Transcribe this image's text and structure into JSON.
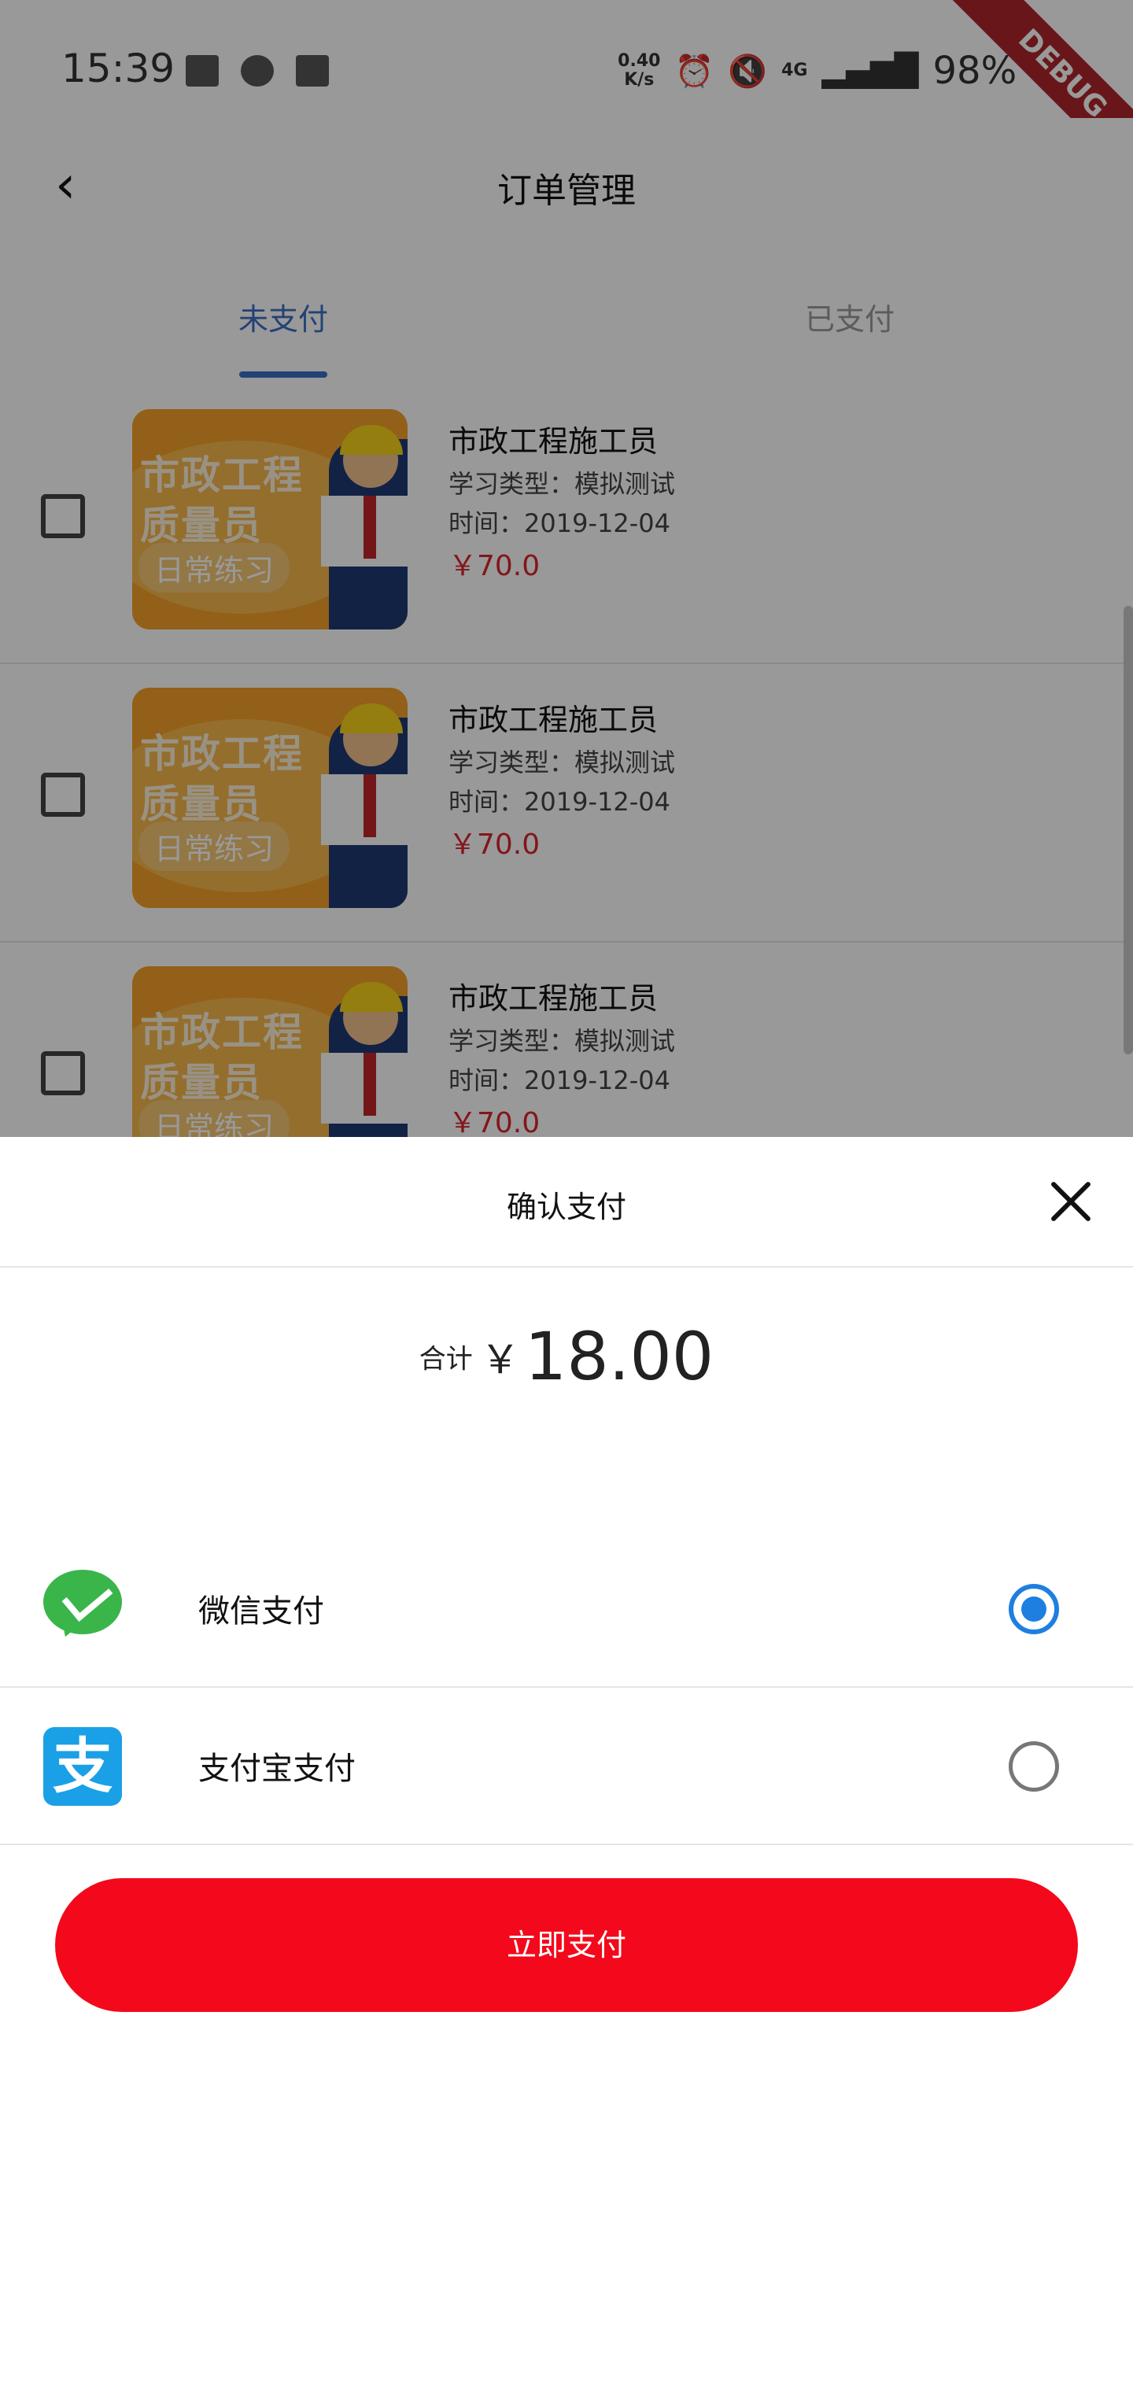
{
  "status_bar": {
    "time": "15:39",
    "net_speed_value": "0.40",
    "net_speed_unit": "K/s",
    "network": "4G",
    "battery": "98%",
    "debug_banner": "DEBUG"
  },
  "app_bar": {
    "back_icon": "back-arrow-icon",
    "title": "订单管理"
  },
  "tabs": [
    {
      "label": "未支付",
      "selected": true
    },
    {
      "label": "已支付",
      "selected": false
    }
  ],
  "orders": [
    {
      "thumb_line1": "市政工程",
      "thumb_line2": "质量员",
      "thumb_tag": "日常练习",
      "title": "市政工程施工员",
      "type": "学习类型：模拟测试",
      "time": "时间：2019-12-04",
      "price": "￥70.0"
    },
    {
      "thumb_line1": "市政工程",
      "thumb_line2": "质量员",
      "thumb_tag": "日常练习",
      "title": "市政工程施工员",
      "type": "学习类型：模拟测试",
      "time": "时间：2019-12-04",
      "price": "￥70.0"
    },
    {
      "thumb_line1": "市政工程",
      "thumb_line2": "质量员",
      "thumb_tag": "日常练习",
      "title": "市政工程施工员",
      "type": "学习类型：模拟测试",
      "time": "时间：2019-12-04",
      "price": "￥70.0"
    }
  ],
  "sheet": {
    "title": "确认支付",
    "close_icon": "close-icon",
    "total_label": "合计",
    "currency": "￥",
    "total_amount": "18.00",
    "methods": [
      {
        "label": "微信支付",
        "icon": "wechat-icon",
        "selected": true
      },
      {
        "label": "支付宝支付",
        "icon": "alipay-icon",
        "icon_glyph": "支",
        "selected": false
      }
    ],
    "pay_button": "立即支付"
  },
  "colors": {
    "accent": "#3b6fc4",
    "price": "#d9262c",
    "pay_button": "#f3091b",
    "radio_selected": "#1f7fe0",
    "wechat": "#39b54a",
    "alipay": "#1aa0e6"
  }
}
